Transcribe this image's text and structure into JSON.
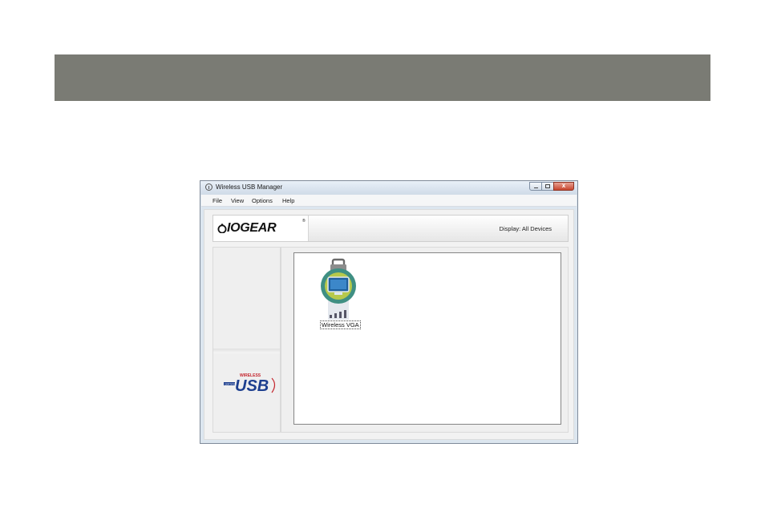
{
  "window": {
    "title": "Wireless USB Manager",
    "close_glyph": "x"
  },
  "menu": {
    "items": [
      "File",
      "View",
      "Options",
      "Help"
    ]
  },
  "banner": {
    "brand": "IOGEAR",
    "brand_mark": "®",
    "display_label": "Display:  All Devices"
  },
  "devices": [
    {
      "label": "Wireless VGA",
      "icon": "wireless-vga-monitor-icon",
      "locked": true
    }
  ],
  "sidebar": {
    "logo": "certified-wireless-usb-logo",
    "logo_text": {
      "top": "WIRELESS",
      "main": "USB",
      "side": "CERTIFIED"
    }
  },
  "colors": {
    "header_bar": "#7a7b74",
    "device_ring": "#3f8f83",
    "device_halo": "#b7c94b"
  }
}
